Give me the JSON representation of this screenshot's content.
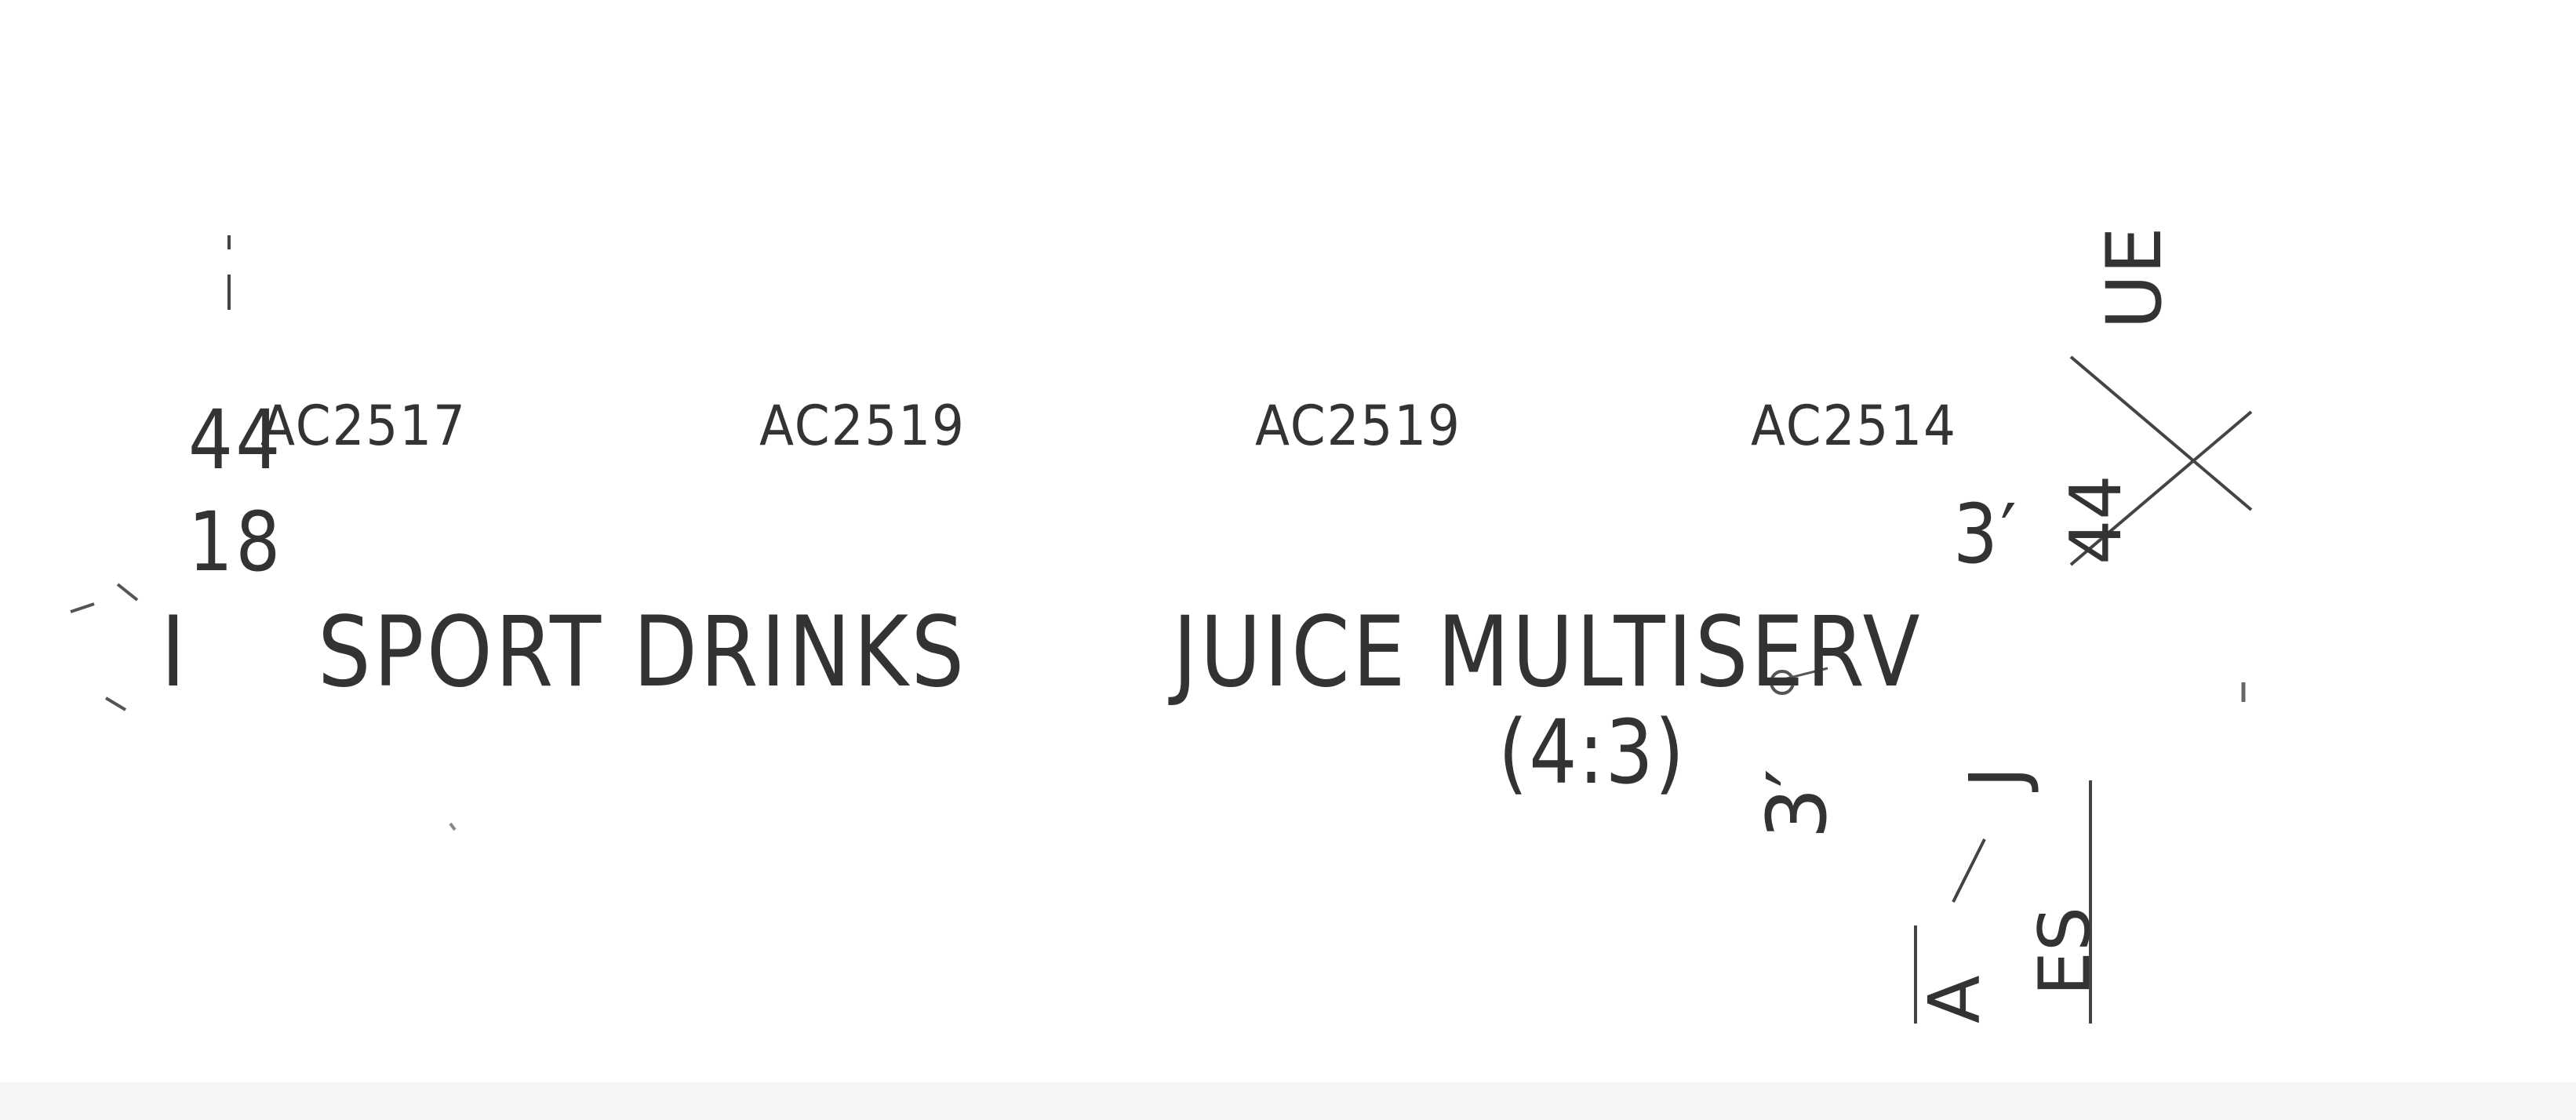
{
  "drawing": {
    "dimensions": {
      "left_44": "44",
      "left_18": "18",
      "right_3ft": "3′",
      "right_44_rot": "44",
      "bottom_3_rot": "3′"
    },
    "codes": [
      "AC2517",
      "AC2519",
      "AC2519",
      "AC2514"
    ],
    "main_label": {
      "marker": "I",
      "sport": "SPORT DRINKS",
      "juice": "JUICE MULTISERV",
      "ratio": "(4:3)"
    },
    "fragments": {
      "top_right": "UE",
      "right_j": "J",
      "right_es": "ES",
      "right_a": "A"
    }
  }
}
